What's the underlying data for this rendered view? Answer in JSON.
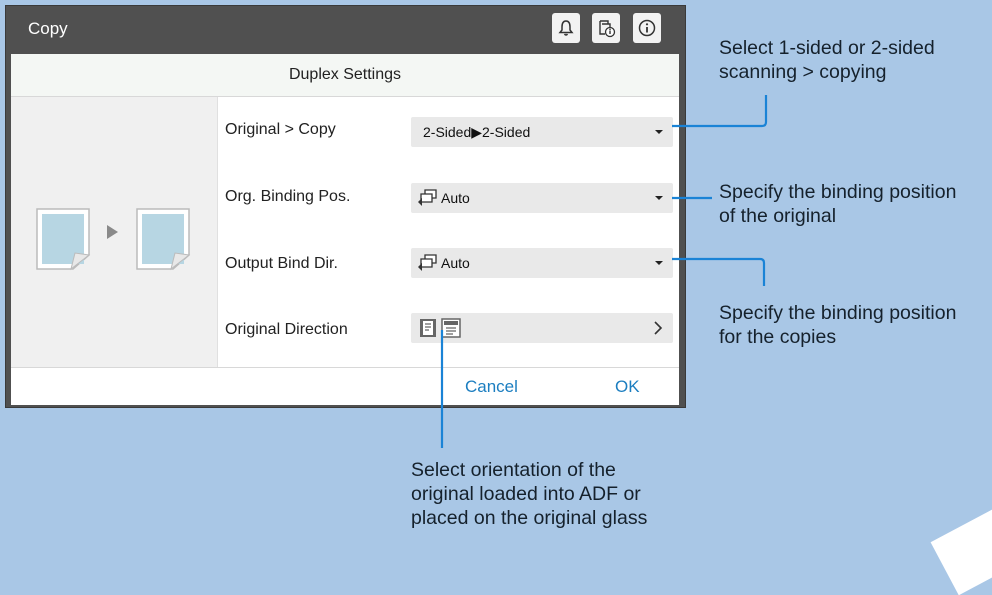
{
  "window": {
    "title": "Copy"
  },
  "dialog": {
    "title": "Duplex Settings",
    "rows": [
      {
        "label": "Original  >  Copy",
        "value": "2-Sided▶2-Sided"
      },
      {
        "label": "Org.  Binding  Pos.",
        "value": "Auto"
      },
      {
        "label": "Output  Bind  Dir.",
        "value": "Auto"
      },
      {
        "label": "Original  Direction",
        "value": ""
      }
    ],
    "cancel_label": "Cancel",
    "ok_label": "OK"
  },
  "callouts": {
    "duplex_line1": "Select 1-sided or 2-sided",
    "duplex_line2": "scanning > copying",
    "binding_original_line1": "Specify the binding position",
    "binding_original_line2": "of the original",
    "binding_copies_line1": "Specify the binding position",
    "binding_copies_line2": "for the copies",
    "orientation_line1": "Select orientation of the",
    "orientation_line2": "original loaded into ADF or",
    "orientation_line3": "placed on the original glass"
  },
  "colors": {
    "accent": "#1c7ec0",
    "callout_line": "#1a83d6",
    "background": "#a9c7e6"
  },
  "icons": [
    "bell-icon",
    "job-status-icon",
    "info-icon",
    "binding-icon",
    "chevron-right-icon",
    "page-icon"
  ]
}
